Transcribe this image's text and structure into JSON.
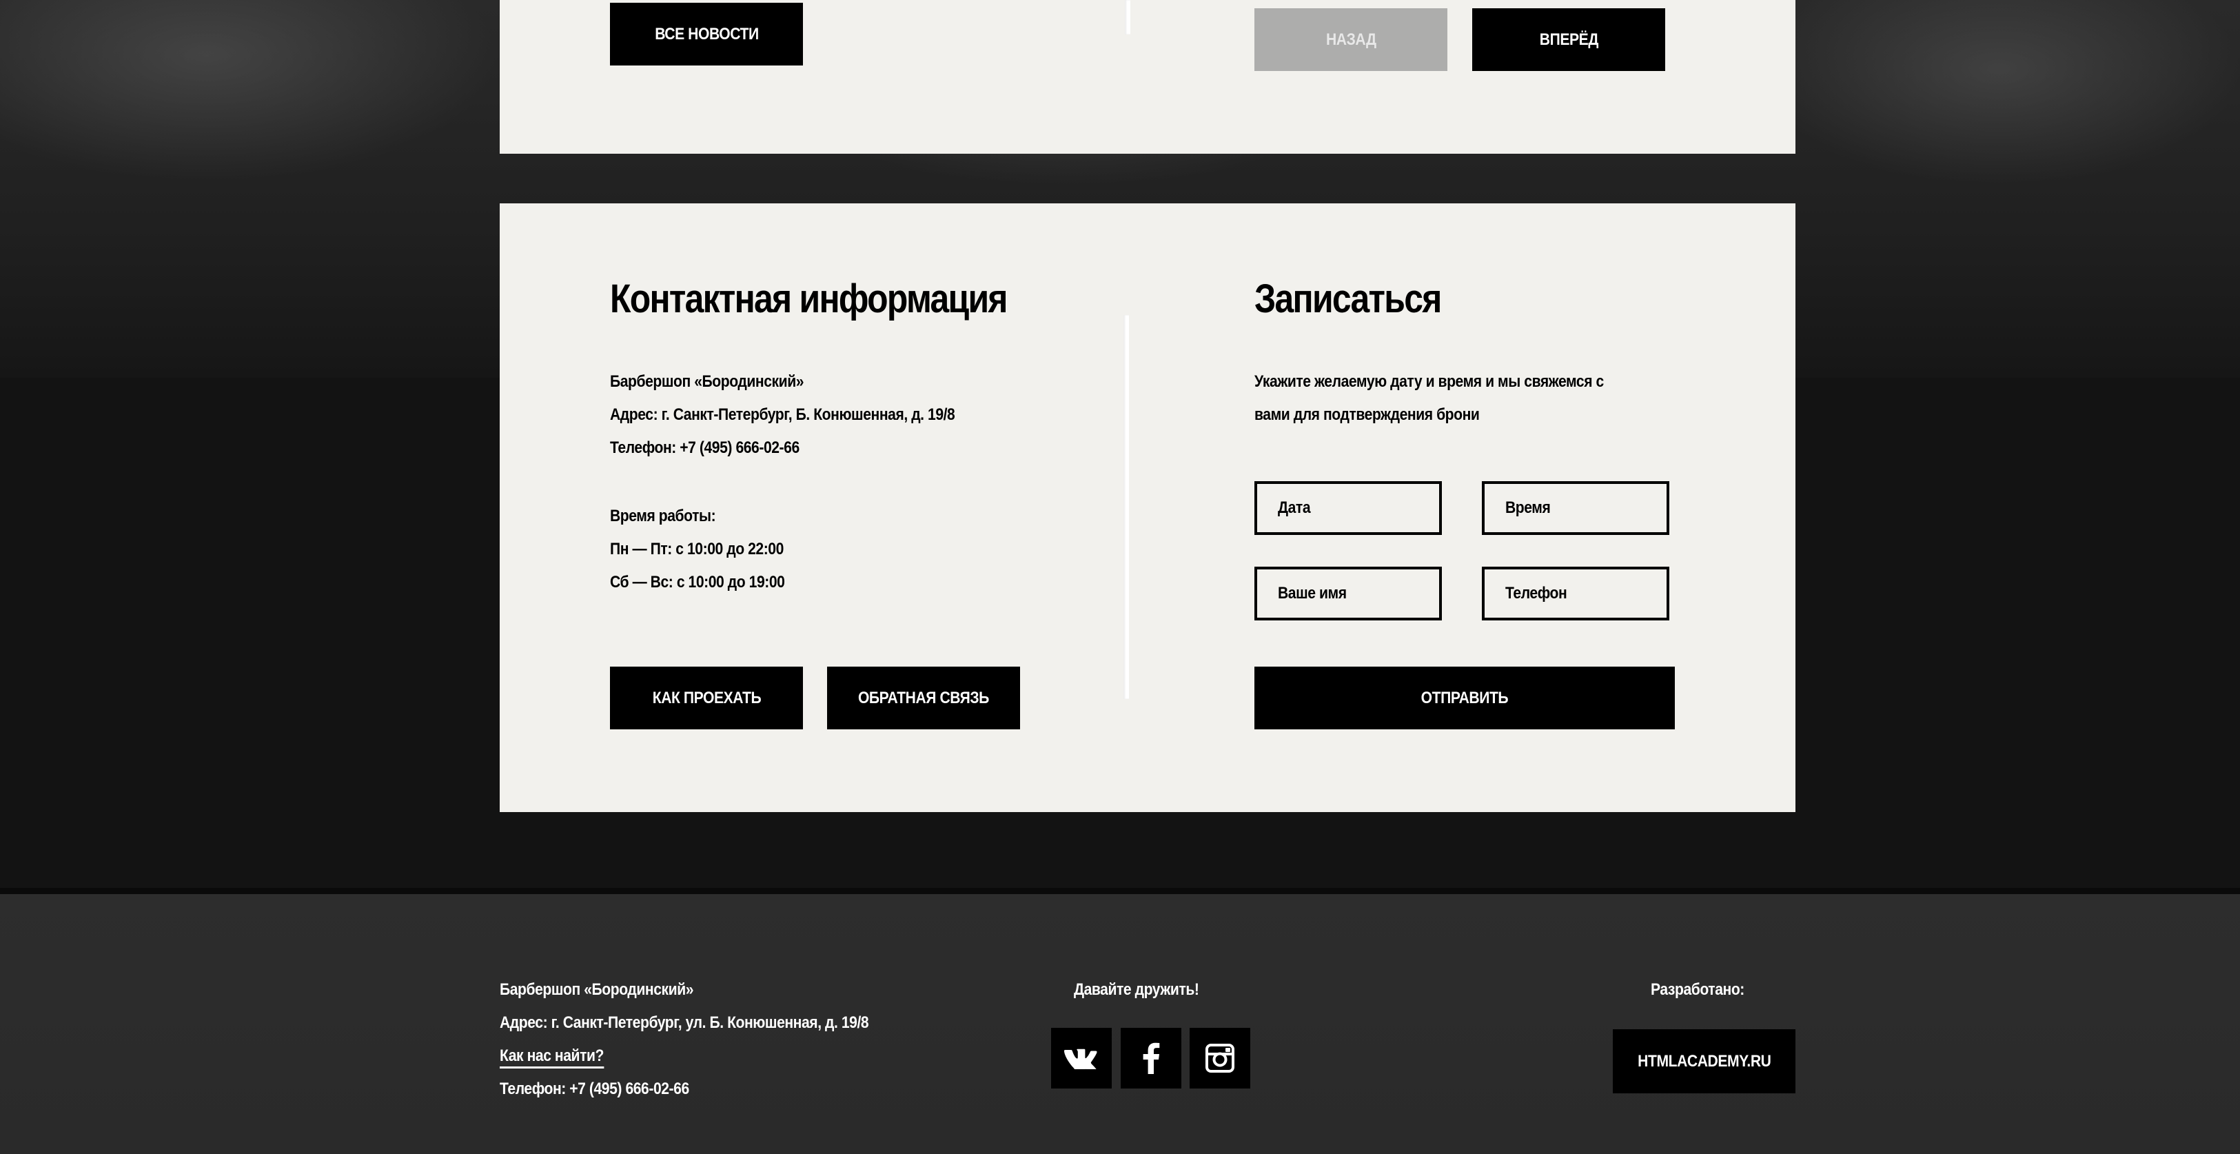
{
  "news": {
    "all_news_button": "Все новости",
    "prev_button": "Назад",
    "next_button": "Вперёд"
  },
  "contacts": {
    "title": "Контактная информация",
    "name": "Барбершоп «Бородинский»",
    "address": "Адрес: г. Санкт-Петербург, Б. Конюшенная, д. 19/8",
    "phone": "Телефон: +7 (495) 666-02-66",
    "hours_label": "Время работы:",
    "hours_weekdays": "Пн — Пт: с 10:00 до 22:00",
    "hours_weekend": "Сб — Вс: с 10:00 до 19:00",
    "route_button": "Как проехать",
    "feedback_button": "Обратная связь"
  },
  "booking": {
    "title": "Записаться",
    "description_line1": "Укажите желаемую дату и время и мы свяжемся с",
    "description_line2": "вами для подтверждения брони",
    "date_placeholder": "Дата",
    "time_placeholder": "Время",
    "name_placeholder": "Ваше имя",
    "phone_placeholder": "Телефон",
    "submit_button": "Отправить"
  },
  "footer": {
    "name": "Барбершоп «Бородинский»",
    "address": "Адрес: г. Санкт-Петербург, ул. Б. Конюшенная, д. 19/8",
    "find_us_link": "Как нас найти?",
    "phone": "Телефон: +7 (495) 666-02-66",
    "social_title": "Давайте дружить!",
    "social_icons": [
      "vk-icon",
      "facebook-icon",
      "instagram-icon"
    ],
    "developed_label": "Разработано:",
    "developer_button": "HTMLAcademy.ru"
  },
  "colors": {
    "panel_bg": "#f2f1ed",
    "button_bg": "#000000",
    "button_disabled_bg": "#adadac",
    "page_bg": "#131313",
    "footer_bg": "#2a2a2a"
  }
}
